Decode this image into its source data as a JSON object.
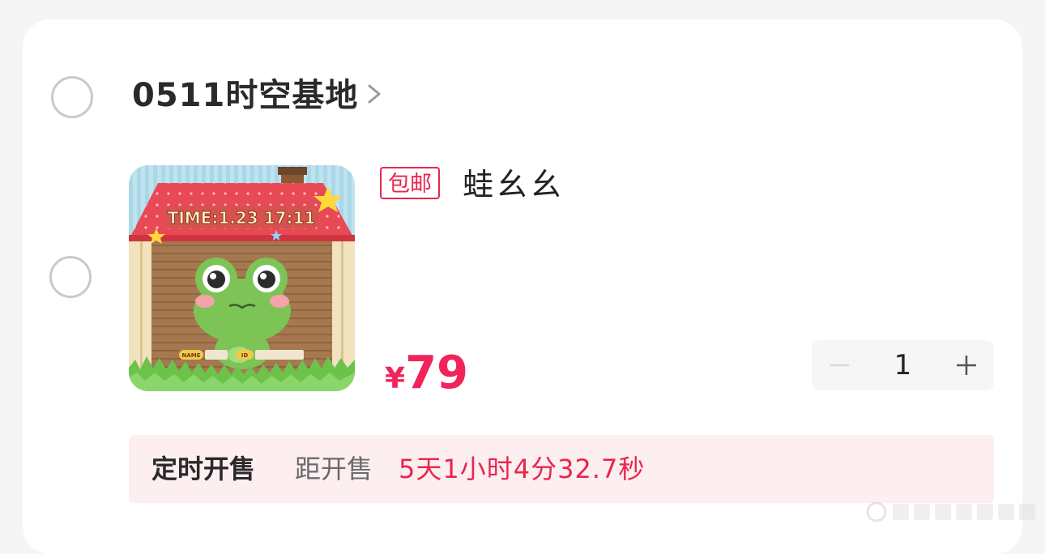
{
  "shop": {
    "name": "0511时空基地",
    "chevron_icon": "chevron-right-icon"
  },
  "item": {
    "badge": "包邮",
    "title": "蛙幺幺",
    "price_symbol": "¥",
    "price_value": "79",
    "quantity": "1",
    "image": {
      "clock_text": "TIME:1.23 17:11",
      "label_name": "NAME",
      "label_id": "ID",
      "icon": "frog-house-image"
    }
  },
  "sale": {
    "label": "定时开售",
    "sub": "距开售",
    "countdown": "5天1小时4分32.7秒"
  },
  "colors": {
    "accent": "#f0245a",
    "badge": "#e8264e",
    "sale_bg": "#fdeef0"
  }
}
